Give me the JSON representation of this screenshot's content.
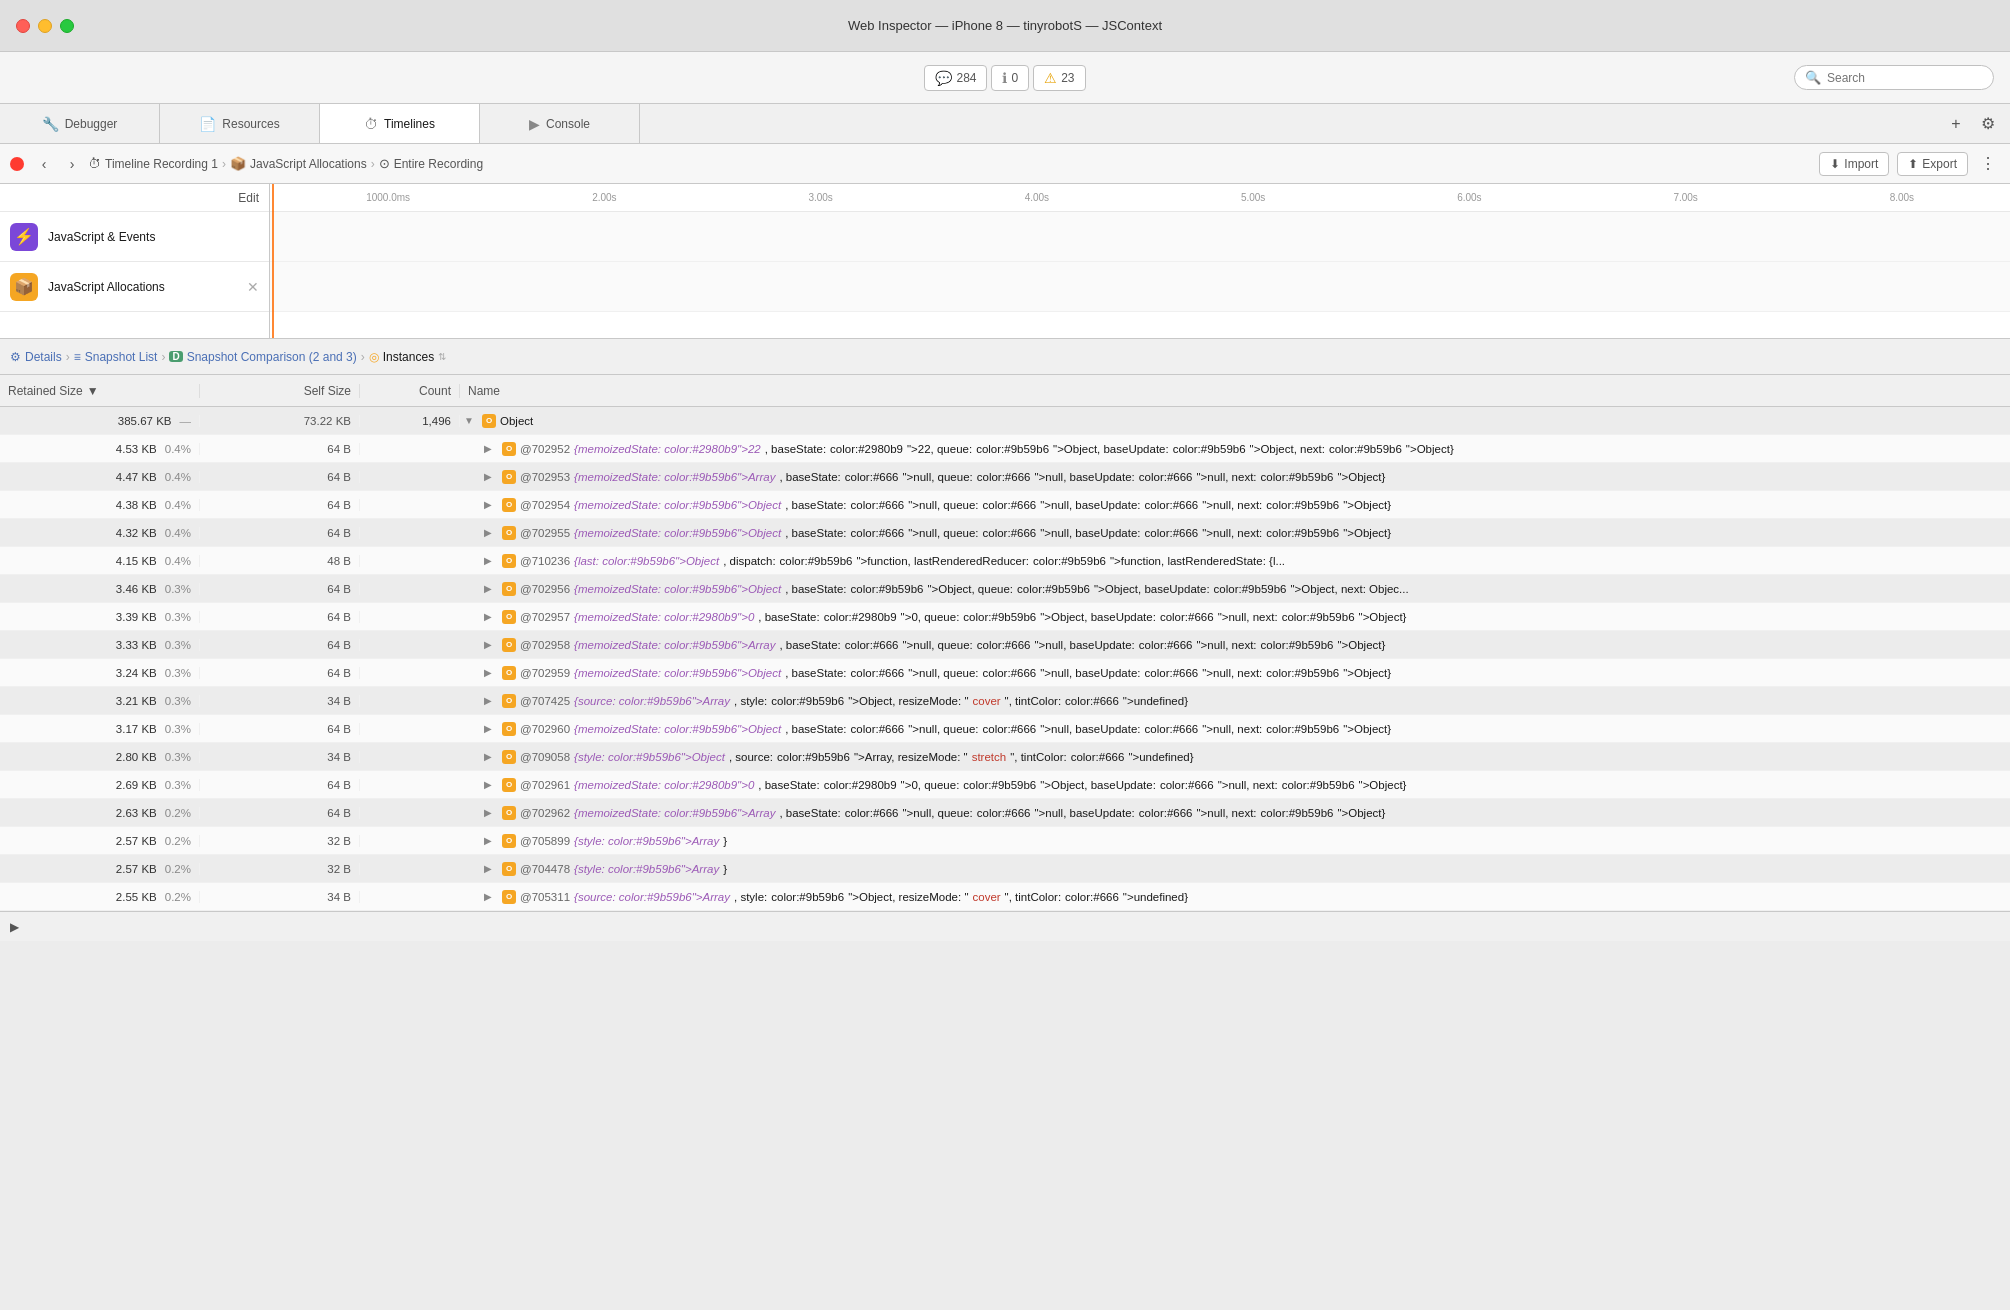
{
  "titleBar": {
    "title": "Web Inspector — iPhone 8 — tinyrobotS — JSContext"
  },
  "toolbar": {
    "badge1": {
      "icon": "💬",
      "count": "284"
    },
    "badge2": {
      "icon": "ℹ",
      "count": "0"
    },
    "badge3": {
      "icon": "⚠",
      "count": "23",
      "warning": true
    },
    "search": {
      "placeholder": "Search"
    }
  },
  "tabs": [
    {
      "id": "debugger",
      "label": "Debugger",
      "icon": "🔧",
      "active": false
    },
    {
      "id": "resources",
      "label": "Resources",
      "icon": "📄",
      "active": false
    },
    {
      "id": "timelines",
      "label": "Timelines",
      "icon": "⏱",
      "active": true
    },
    {
      "id": "console",
      "label": "Console",
      "icon": "▶",
      "active": false
    }
  ],
  "navBar": {
    "breadcrumbs": [
      {
        "icon": "⏱",
        "label": "Timeline Recording 1"
      },
      {
        "icon": "📦",
        "label": "JavaScript Allocations"
      },
      {
        "icon": "⊙",
        "label": "Entire Recording"
      }
    ],
    "importBtn": "Import",
    "exportBtn": "Export"
  },
  "timeline": {
    "editLabel": "Edit",
    "rows": [
      {
        "id": "js-events",
        "icon": "⚡",
        "iconStyle": "purple",
        "label": "JavaScript & Events",
        "hasClose": false
      },
      {
        "id": "js-alloc",
        "icon": "📦",
        "iconStyle": "orange",
        "label": "JavaScript Allocations",
        "hasClose": true
      }
    ],
    "rulerTicks": [
      "1000.0ms",
      "2.00s",
      "3.00s",
      "4.00s",
      "5.00s",
      "6.00s",
      "7.00s",
      "8.00s"
    ]
  },
  "sectionNav": [
    {
      "id": "details",
      "label": "Details",
      "icon": "⚙",
      "active": false
    },
    {
      "id": "snapshot-list",
      "label": "Snapshot List",
      "icon": "≡",
      "active": false
    },
    {
      "id": "snapshot-comparison",
      "label": "Snapshot Comparison (2 and 3)",
      "icon": "D",
      "active": false
    },
    {
      "id": "instances",
      "label": "Instances",
      "icon": "◎",
      "active": true
    }
  ],
  "tableHeader": {
    "retainedSize": "Retained Size",
    "selfSize": "Self Size",
    "count": "Count",
    "name": "Name"
  },
  "tableRows": [
    {
      "retained": "385.67 KB",
      "selfPercent": "—",
      "self": "73.22 KB",
      "count": "1,496",
      "indent": 0,
      "expandable": true,
      "expanded": true,
      "objName": "Object"
    },
    {
      "retained": "4.53 KB",
      "selfPercent": "0.4%",
      "self": "64 B",
      "count": "",
      "indent": 1,
      "expandable": true,
      "expanded": false,
      "objId": "@702952",
      "objProps": "{memoizedState: 22, baseState: 22, queue: Object, baseUpdate: Object, next: Object}"
    },
    {
      "retained": "4.47 KB",
      "selfPercent": "0.4%",
      "self": "64 B",
      "count": "",
      "indent": 1,
      "expandable": true,
      "expanded": false,
      "objId": "@702953",
      "objProps": "{memoizedState: Array, baseState: null, queue: null, baseUpdate: null, next: Object}"
    },
    {
      "retained": "4.38 KB",
      "selfPercent": "0.4%",
      "self": "64 B",
      "count": "",
      "indent": 1,
      "expandable": true,
      "expanded": false,
      "objId": "@702954",
      "objProps": "{memoizedState: Object, baseState: null, queue: null, baseUpdate: null, next: Object}"
    },
    {
      "retained": "4.32 KB",
      "selfPercent": "0.4%",
      "self": "64 B",
      "count": "",
      "indent": 1,
      "expandable": true,
      "expanded": false,
      "objId": "@702955",
      "objProps": "{memoizedState: Object, baseState: null, queue: null, baseUpdate: null, next: Object}"
    },
    {
      "retained": "4.15 KB",
      "selfPercent": "0.4%",
      "self": "48 B",
      "count": "",
      "indent": 1,
      "expandable": true,
      "expanded": false,
      "objId": "@710236",
      "objProps": "{last: Object, dispatch: function, lastRenderedReducer: function, lastRenderedState: {l..."
    },
    {
      "retained": "3.46 KB",
      "selfPercent": "0.3%",
      "self": "64 B",
      "count": "",
      "indent": 1,
      "expandable": true,
      "expanded": false,
      "objId": "@702956",
      "objProps": "{memoizedState: Object, baseState: Object, queue: Object, baseUpdate: Object, next: Objec..."
    },
    {
      "retained": "3.39 KB",
      "selfPercent": "0.3%",
      "self": "64 B",
      "count": "",
      "indent": 1,
      "expandable": true,
      "expanded": false,
      "objId": "@702957",
      "objProps": "{memoizedState: 0, baseState: 0, queue: Object, baseUpdate: null, next: Object}"
    },
    {
      "retained": "3.33 KB",
      "selfPercent": "0.3%",
      "self": "64 B",
      "count": "",
      "indent": 1,
      "expandable": true,
      "expanded": false,
      "objId": "@702958",
      "objProps": "{memoizedState: Array, baseState: null, queue: null, baseUpdate: null, next: Object}"
    },
    {
      "retained": "3.24 KB",
      "selfPercent": "0.3%",
      "self": "64 B",
      "count": "",
      "indent": 1,
      "expandable": true,
      "expanded": false,
      "objId": "@702959",
      "objProps": "{memoizedState: Object, baseState: null, queue: null, baseUpdate: null, next: Object}"
    },
    {
      "retained": "3.21 KB",
      "selfPercent": "0.3%",
      "self": "34 B",
      "count": "",
      "indent": 1,
      "expandable": true,
      "expanded": false,
      "objId": "@707425",
      "objProps": "{source: Array, style: Object, resizeMode: \"cover\", tintColor: undefined}"
    },
    {
      "retained": "3.17 KB",
      "selfPercent": "0.3%",
      "self": "64 B",
      "count": "",
      "indent": 1,
      "expandable": true,
      "expanded": false,
      "objId": "@702960",
      "objProps": "{memoizedState: Object, baseState: null, queue: null, baseUpdate: null, next: Object}"
    },
    {
      "retained": "2.80 KB",
      "selfPercent": "0.3%",
      "self": "34 B",
      "count": "",
      "indent": 1,
      "expandable": true,
      "expanded": false,
      "objId": "@709058",
      "objProps": "{style: Object, source: Array, resizeMode: \"stretch\", tintColor: undefined}"
    },
    {
      "retained": "2.69 KB",
      "selfPercent": "0.3%",
      "self": "64 B",
      "count": "",
      "indent": 1,
      "expandable": true,
      "expanded": false,
      "objId": "@702961",
      "objProps": "{memoizedState: 0, baseState: 0, queue: Object, baseUpdate: null, next: Object}"
    },
    {
      "retained": "2.63 KB",
      "selfPercent": "0.2%",
      "self": "64 B",
      "count": "",
      "indent": 1,
      "expandable": true,
      "expanded": false,
      "objId": "@702962",
      "objProps": "{memoizedState: Array, baseState: null, queue: null, baseUpdate: null, next: Object}"
    },
    {
      "retained": "2.57 KB",
      "selfPercent": "0.2%",
      "self": "32 B",
      "count": "",
      "indent": 1,
      "expandable": true,
      "expanded": false,
      "objId": "@705899",
      "objProps": "{style: Array}"
    },
    {
      "retained": "2.57 KB",
      "selfPercent": "0.2%",
      "self": "32 B",
      "count": "",
      "indent": 1,
      "expandable": true,
      "expanded": false,
      "objId": "@704478",
      "objProps": "{style: Array}"
    },
    {
      "retained": "2.55 KB",
      "selfPercent": "0.2%",
      "self": "34 B",
      "count": "",
      "indent": 1,
      "expandable": true,
      "expanded": false,
      "objId": "@705311",
      "objProps": "{source: Array, style: Object, resizeMode: \"cover\", tintColor: undefined}"
    }
  ],
  "statusBar": {
    "icon": "▶",
    "text": ""
  }
}
